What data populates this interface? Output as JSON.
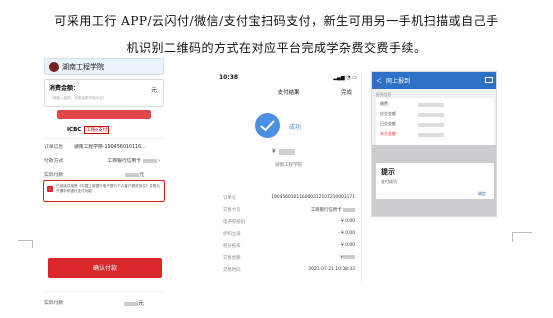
{
  "caption": {
    "line1": "可采用工行 APP/云闪付/微信/支付宝扫码支付，新生可用另一手机扫描或自己手",
    "line2": "机识别二维码的方式在对应平台完成学杂费交费手续。"
  },
  "phone1": {
    "school": "湖南工程学院",
    "fee_label": "消费金额：",
    "fee_unit": "元",
    "fee_tip": "（请输入金额，消费金额不能为空）",
    "icbc_brand": "ICBC",
    "icbc_tag": "工银e支付",
    "rows": [
      {
        "k": "订单信息",
        "v": "湖南工程学院-190456010116..."
      },
      {
        "k": "付款方式",
        "v": "工商银行信用卡"
      },
      {
        "k": "实际付款",
        "v": "元"
      }
    ],
    "agree_text": "已阅读并接受《中国工商银行电子银行个人客户服务协议》并默认开通手机银行支付功能",
    "agree_check": "✓",
    "pay_button": "确认付款",
    "bottom_label": "实际付款",
    "bottom_unit": "元"
  },
  "phone2": {
    "time": "10:38",
    "status_icons": "▂▄▆ ◔ ▭",
    "title": "支付结果",
    "done": "完成",
    "success": "成功",
    "yen": "¥",
    "school": "湖南工程学院",
    "rows": [
      {
        "k": "订单号",
        "v": "190456010116000312107210003171"
      },
      {
        "k": "交易卡号",
        "v": "工商银行信用卡"
      },
      {
        "k": "电子券抵扣",
        "v": "- ¥ 0.00"
      },
      {
        "k": "折扣立减",
        "v": "- ¥ 0.00"
      },
      {
        "k": "积分抵扣",
        "v": "- ¥ 0.00"
      },
      {
        "k": "交易金额",
        "v": "¥"
      },
      {
        "k": "交易时间",
        "v": "2021-07-21 10:38:33"
      }
    ]
  },
  "phone3": {
    "back": "＜",
    "title": "网上报到",
    "sub": "报到信息",
    "rows": [
      {
        "k": "缴费",
        "v": ""
      },
      {
        "k": "应交金额",
        "v": ""
      },
      {
        "k": "已交金额",
        "v": ""
      },
      {
        "k": "未交金额",
        "v": ""
      }
    ],
    "dialog_title": "提示",
    "dialog_msg": "支付成功",
    "dialog_ok": "确定"
  }
}
